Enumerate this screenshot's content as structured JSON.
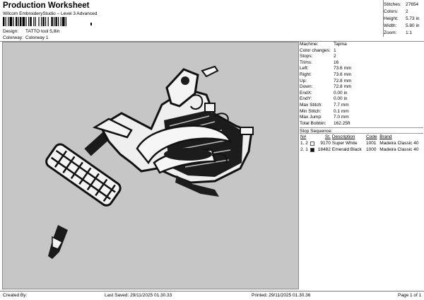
{
  "header": {
    "title": "Production Worksheet",
    "subtitle": "Wilcom EmbroideryStudio – Level 3 Advanced",
    "design_label": "Design:",
    "design_value": "TATTO tool 5,8in",
    "colorway_label": "Colorway:",
    "colorway_value": "Colorway 1"
  },
  "summary": [
    {
      "label": "Stitches:",
      "value": "27654"
    },
    {
      "label": "Colors:",
      "value": "2"
    },
    {
      "label": "Height:",
      "value": "5.73 in"
    },
    {
      "label": "Width:",
      "value": "5.80 in"
    },
    {
      "label": "Zoom:",
      "value": "1:1"
    }
  ],
  "params": [
    {
      "label": "Machine:",
      "value": "Tajima"
    },
    {
      "label": "Color changes:",
      "value": "1"
    },
    {
      "label": "Stops:",
      "value": "2"
    },
    {
      "label": "Trims:",
      "value": "16"
    },
    {
      "label": "Left:",
      "value": "73.6 mm"
    },
    {
      "label": "Right:",
      "value": "73.6 mm"
    },
    {
      "label": "Up:",
      "value": "72.8 mm"
    },
    {
      "label": "Down:",
      "value": "72.8 mm"
    },
    {
      "label": "EndX:",
      "value": "0.00 in"
    },
    {
      "label": "EndY:",
      "value": "0.00 in"
    },
    {
      "label": "Max Stitch:",
      "value": "7.7 mm"
    },
    {
      "label": "Min Stitch:",
      "value": "0.1 mm"
    },
    {
      "label": "Max Jump:",
      "value": "7.0 mm"
    },
    {
      "label": "Total Bobbin:",
      "value": "162.25ft"
    }
  ],
  "stop_sequence": {
    "title": "Stop Sequence:",
    "columns": [
      "N#",
      "St.",
      "Description",
      "Code",
      "Brand"
    ],
    "rows": [
      {
        "index": "1.",
        "n": "2",
        "color": "#ffffff",
        "st": "9170",
        "description": "Super White",
        "code": "1001",
        "brand": "Madeira Classic 40"
      },
      {
        "index": "2.",
        "n": "1",
        "color": "#111111",
        "st": "18482",
        "description": "Emerald Black",
        "code": "1000",
        "brand": "Madeira Classic 40"
      }
    ]
  },
  "footer": {
    "created_by": "Created By:",
    "last_saved": "Last Saved: 29/11/2025 01.30.33",
    "printed": "Printed: 29/11/2025 01.30.36",
    "page": "Page 1 of 1"
  }
}
